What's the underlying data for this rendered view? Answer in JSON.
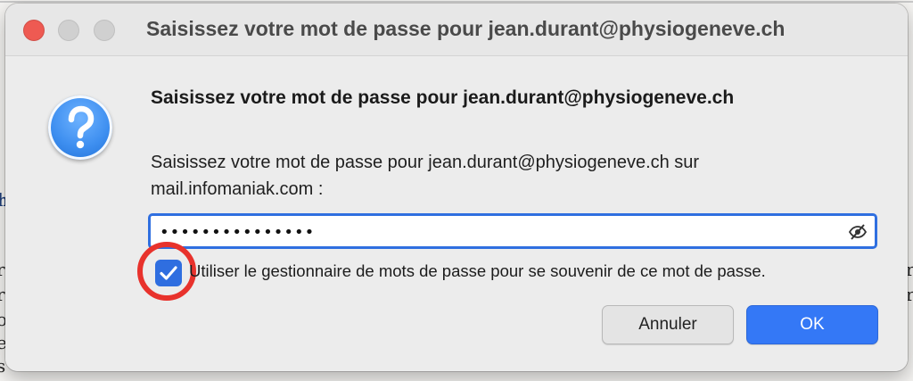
{
  "window": {
    "title": "Saisissez votre mot de passe pour jean.durant@physiogeneve.ch"
  },
  "dialog": {
    "heading": "Saisissez votre mot de passe pour jean.durant@physiogeneve.ch",
    "message": "Saisissez votre mot de passe pour jean.durant@physiogeneve.ch sur mail.infomaniak.com :",
    "password_mask": "•••••••••••••••",
    "remember_label": "Utiliser le gestionnaire de mots de passe pour se souvenir de ce mot de passe.",
    "remember_checked": true,
    "cancel_label": "Annuler",
    "ok_label": "OK"
  },
  "icons": {
    "dialog_icon": "question-icon",
    "password_toggle": "eye-slash-icon",
    "checkbox_mark": "checkmark-icon"
  },
  "colors": {
    "accent": "#3478f6",
    "annotation": "#e8322c",
    "close_button": "#ee5a52"
  }
}
